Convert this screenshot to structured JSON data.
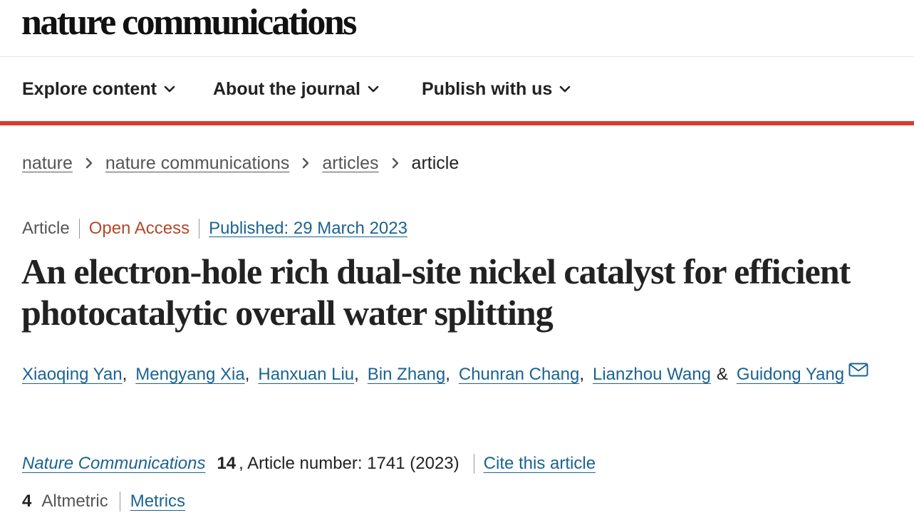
{
  "masthead": {
    "logo_text": "nature communications"
  },
  "nav": {
    "items": [
      {
        "label": "Explore content",
        "icon": "chevron-down-icon"
      },
      {
        "label": "About the journal",
        "icon": "chevron-down-icon"
      },
      {
        "label": "Publish with us",
        "icon": "chevron-down-icon"
      }
    ],
    "accent_color": "#e0392b"
  },
  "breadcrumb": {
    "items": [
      "nature",
      "nature communications",
      "articles"
    ],
    "current": "article",
    "separator_icon": "chevron-right-icon"
  },
  "article_meta": {
    "type": "Article",
    "access": "Open Access",
    "published": "Published: 29 March 2023",
    "access_color": "#b3482b",
    "link_color": "#1a6391"
  },
  "title": "An electron-hole rich dual-site nickel catalyst for efficient photocatalytic overall water splitting",
  "authors": {
    "names": [
      "Xiaoqing Yan",
      "Mengyang Xia",
      "Hanxuan Liu",
      "Bin Zhang",
      "Chunran Chang",
      "Lianzhou Wang",
      "Guidong Yang"
    ],
    "separator": ",",
    "conjunction": "&",
    "corresponding_icon": "envelope-icon"
  },
  "citation": {
    "journal": "Nature Communications",
    "volume": "14",
    "article_number_text": ", Article number: 1741 (2023)",
    "cite_label": "Cite this article"
  },
  "metrics": {
    "altmetric_score": "4",
    "altmetric_label": "Altmetric",
    "metrics_label": "Metrics"
  }
}
